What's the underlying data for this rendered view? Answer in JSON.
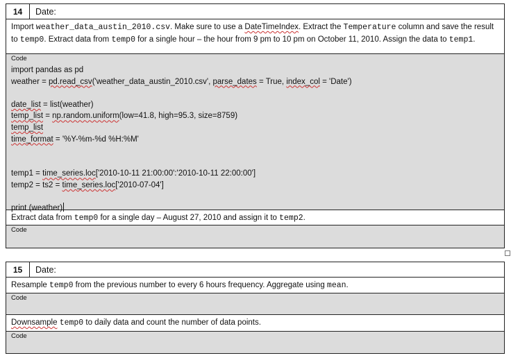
{
  "q14": {
    "number": "14",
    "date_label": "Date:",
    "instr1": {
      "p1": "Import ",
      "file": "weather_data_austin_2010.csv",
      "p2": ". Make sure to use a ",
      "dti": "DateTimeIndex",
      "p3": ". Extract the ",
      "col": "Temperature",
      "p4": " column and save the result to ",
      "var1": "temp0",
      "p5": ".  Extract data from ",
      "var2": "temp0",
      "p6": " for a single hour – the hour from 9 pm to 10 pm on October 11, 2010. Assign the data to ",
      "var3": "temp1",
      "p7": "."
    },
    "code_label": "Code",
    "code": {
      "l1": "import pandas as pd",
      "l2a": "weather = ",
      "l2b": "pd.read_csv",
      "l2c": "('weather_data_austin_2010.csv', ",
      "l2d": "parse_dates",
      "l2e": " = True, ",
      "l2f": "index_col",
      "l2g": " = 'Date')",
      "l3a": "date_list",
      "l3b": " = list(weather)",
      "l4a": "temp_list",
      "l4b": " = ",
      "l4c": "np.random.uniform",
      "l4d": "(low=41.8, high=95.3, size=8759)",
      "l5": "temp_list",
      "l6a": "time_format",
      "l6b": " = '%Y-%m-%d %H:%M'",
      "l7a": "temp1 = ",
      "l7b": "time_series.loc",
      "l7c": "['2010-10-11 21:00:00':'2010-10-11 22:00:00']",
      "l8a": "temp2 = ts2 = ",
      "l8b": "time_series.loc",
      "l8c": "['2010-07-04']",
      "l9": "print (weather)"
    },
    "instr2": {
      "p1": "Extract data from ",
      "var": "temp0",
      "p2": " for a single day – August 27, 2010 and assign it to ",
      "var2": "temp2",
      "p3": "."
    },
    "code_label2": "Code"
  },
  "q15": {
    "number": "15",
    "date_label": "Date:",
    "instr1": {
      "p1": "Resample ",
      "var": "temp0",
      "p2": " from the previous number to every 6 hours frequency. Aggregate using ",
      "fn": "mean",
      "p3": "."
    },
    "code_label": "Code",
    "instr2": {
      "p1": "Downsample",
      "p2": " ",
      "var": "temp0",
      "p3": " to daily data and count the number of data points."
    },
    "code_label2": "Code"
  }
}
